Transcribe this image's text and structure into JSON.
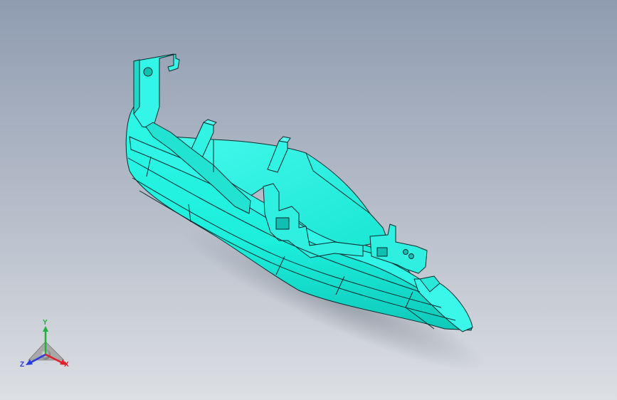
{
  "viewport": {
    "background_top": "#8e9bb0",
    "background_bottom": "#d6d9de",
    "part_color": "#1cf3e0",
    "part_shade": "#0fbfb2",
    "edge_color": "#0b2b2b"
  },
  "triad": {
    "x_label": "X",
    "y_label": "Y",
    "z_label": "Z",
    "x_color": "#e0202a",
    "y_color": "#22b040",
    "z_color": "#2a3adf"
  }
}
